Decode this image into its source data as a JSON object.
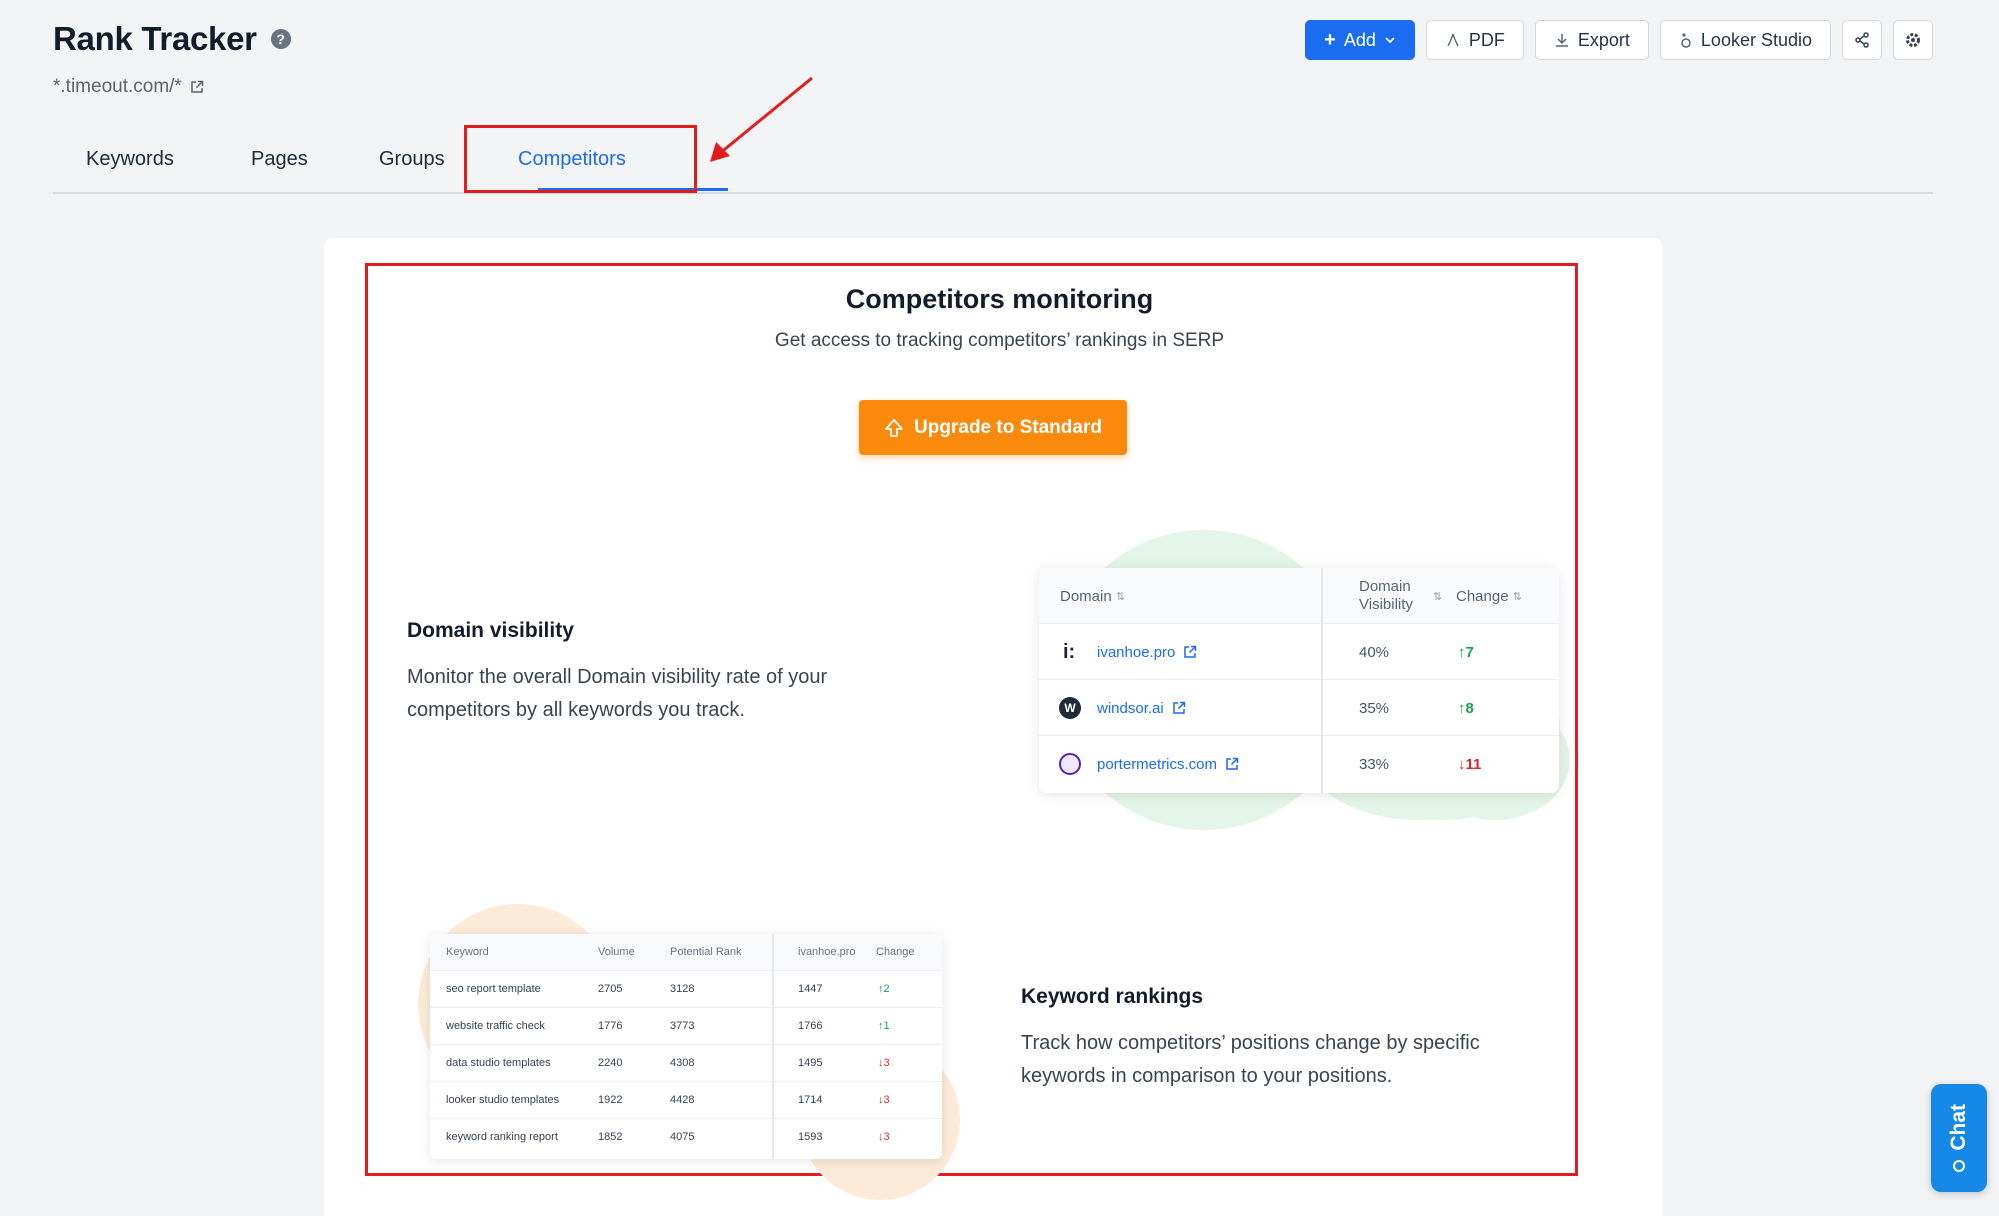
{
  "header": {
    "title": "Rank Tracker",
    "help": "?",
    "site_url": "*.timeout.com/*"
  },
  "toolbar": {
    "add": "Add",
    "pdf": "PDF",
    "export": "Export",
    "looker": "Looker Studio"
  },
  "tabs": [
    {
      "label": "Keywords"
    },
    {
      "label": "Pages"
    },
    {
      "label": "Groups"
    },
    {
      "label": "Competitors",
      "active": true
    }
  ],
  "promo": {
    "title": "Competitors monitoring",
    "subtitle": "Get access to tracking competitors’ rankings in SERP",
    "upgrade_label": "Upgrade to Standard"
  },
  "features": {
    "domain_visibility": {
      "title": "Domain visibility",
      "desc": "Monitor the overall Domain visibility rate of your competitors by all keywords you track."
    },
    "keyword_rankings": {
      "title": "Keyword rankings",
      "desc": "Track how competitors’ positions change by specific keywords in comparison to your positions."
    }
  },
  "domain_table": {
    "headers": {
      "domain": "Domain",
      "visibility_1": "Domain",
      "visibility_2": "Visibility",
      "change": "Change"
    },
    "rows": [
      {
        "domain": "ivanhoe.pro",
        "visibility": "40%",
        "change": "7",
        "dir": "up"
      },
      {
        "domain": "windsor.ai",
        "visibility": "35%",
        "change": "8",
        "dir": "up"
      },
      {
        "domain": "portermetrics.com",
        "visibility": "33%",
        "change": "11",
        "dir": "down"
      }
    ]
  },
  "keyword_table": {
    "headers": {
      "keyword": "Keyword",
      "volume": "Volume",
      "potential": "Potential Rank",
      "competitor": "ivanhoe.pro",
      "change": "Change"
    },
    "rows": [
      {
        "keyword": "seo report template",
        "volume": "2705",
        "potential": "3128",
        "competitor": "1447",
        "change": "2",
        "dir": "up"
      },
      {
        "keyword": "website traffic check",
        "volume": "1776",
        "potential": "3773",
        "competitor": "1766",
        "change": "1",
        "dir": "up"
      },
      {
        "keyword": "data studio templates",
        "volume": "2240",
        "potential": "4308",
        "competitor": "1495",
        "change": "3",
        "dir": "down"
      },
      {
        "keyword": "looker studio templates",
        "volume": "1922",
        "potential": "4428",
        "competitor": "1714",
        "change": "3",
        "dir": "down"
      },
      {
        "keyword": "keyword ranking report",
        "volume": "1852",
        "potential": "4075",
        "competitor": "1593",
        "change": "3",
        "dir": "down"
      }
    ]
  },
  "chat": {
    "label": "Chat"
  },
  "colors": {
    "primary": "#1a6cf0",
    "upgrade": "#f98a0c",
    "highlight": "#e11d20",
    "up": "#16a34a",
    "down": "#dc2626"
  }
}
